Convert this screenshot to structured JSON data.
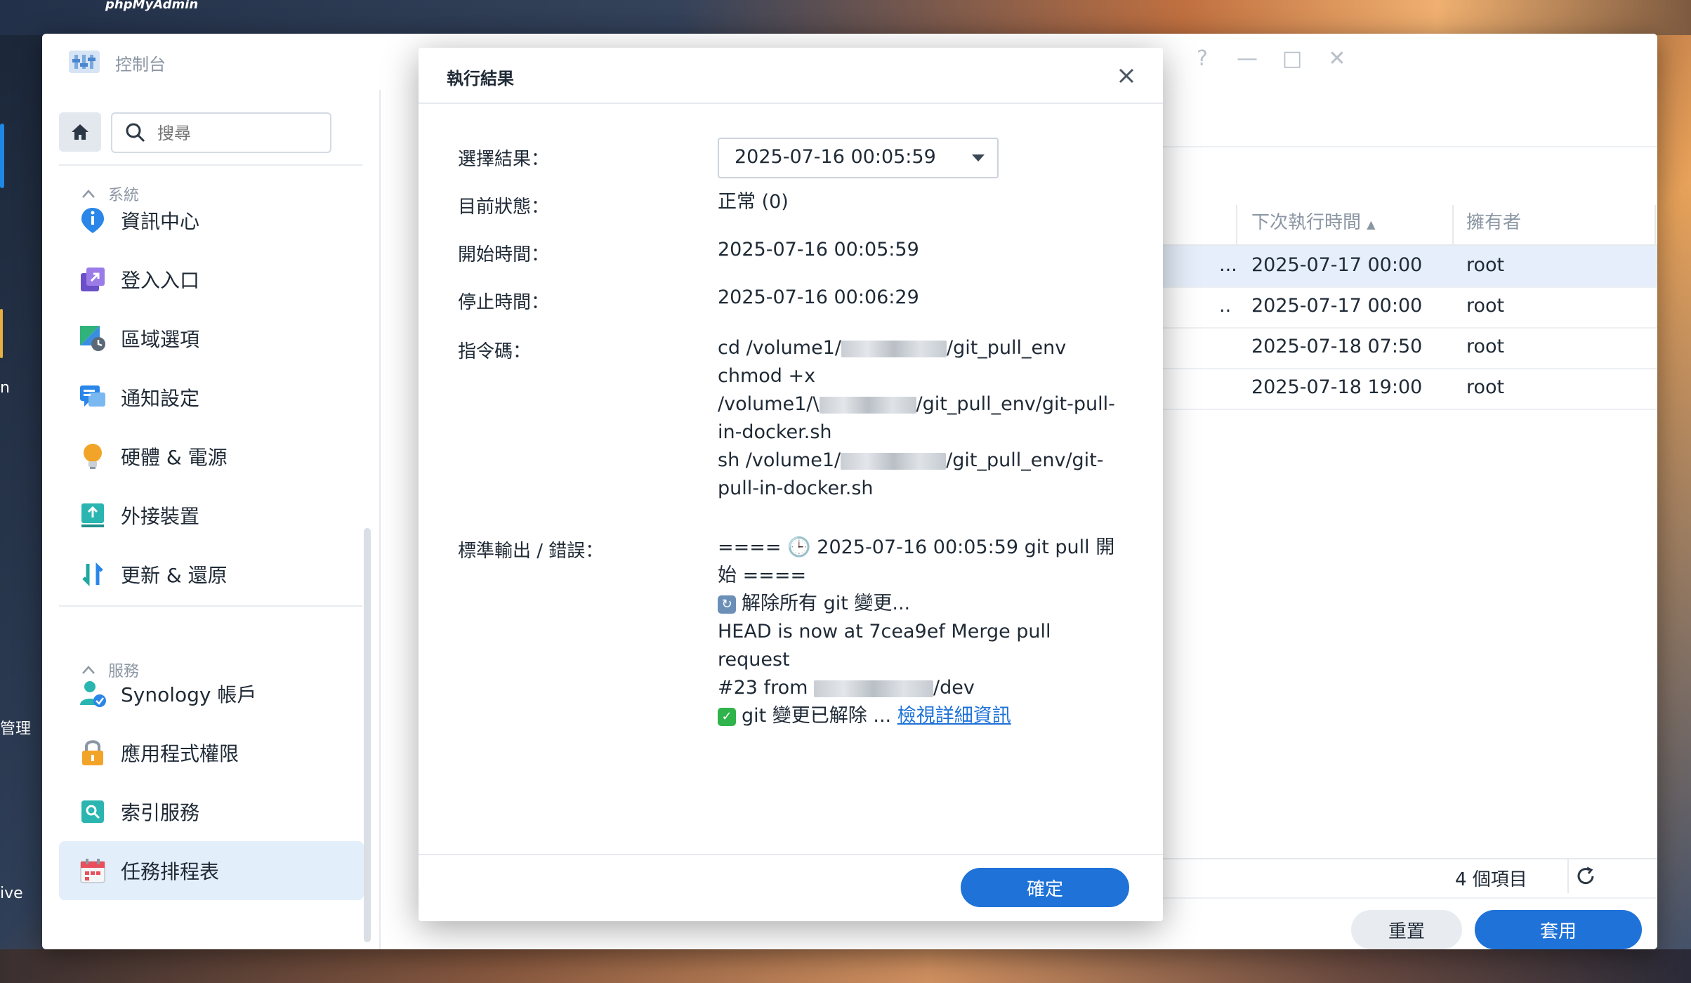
{
  "desktop": {
    "top_label": "phpMyAdmin",
    "left_label_1": "管理",
    "left_label_2": "ive",
    "left_label_3": "n"
  },
  "window": {
    "title": "控制台",
    "controls": [
      "?",
      "—",
      "□",
      "✕"
    ]
  },
  "sidebar": {
    "search_placeholder": "搜尋",
    "section_system": "系統",
    "section_services": "服務",
    "items": [
      {
        "label": "資訊中心",
        "icon": "info-icon"
      },
      {
        "label": "登入入口",
        "icon": "login-portal-icon"
      },
      {
        "label": "區域選項",
        "icon": "regional-options-icon"
      },
      {
        "label": "通知設定",
        "icon": "notification-icon"
      },
      {
        "label": "硬體 & 電源",
        "icon": "hardware-power-icon"
      },
      {
        "label": "外接裝置",
        "icon": "external-devices-icon"
      },
      {
        "label": "更新 & 還原",
        "icon": "update-restore-icon"
      },
      {
        "label": "Synology 帳戶",
        "icon": "synology-account-icon"
      },
      {
        "label": "應用程式權限",
        "icon": "app-privileges-icon"
      },
      {
        "label": "索引服務",
        "icon": "indexing-service-icon"
      },
      {
        "label": "任務排程表",
        "icon": "task-scheduler-icon"
      }
    ]
  },
  "table": {
    "headers": [
      "下次執行時間",
      "擁有者"
    ],
    "rows": [
      {
        "prefix": "...",
        "next_run": "2025-07-17 00:00",
        "owner": "root"
      },
      {
        "prefix": "..",
        "next_run": "2025-07-17 00:00",
        "owner": "root"
      },
      {
        "prefix": "",
        "next_run": "2025-07-18 07:50",
        "owner": "root"
      },
      {
        "prefix": "",
        "next_run": "2025-07-18 19:00",
        "owner": "root"
      }
    ],
    "item_count": "4 個項目",
    "reset_label": "重置",
    "apply_label": "套用"
  },
  "dialog": {
    "title": "執行結果",
    "labels": {
      "select_result": "選擇結果：",
      "current_status": "目前狀態：",
      "start_time": "開始時間：",
      "stop_time": "停止時間：",
      "command": "指令碼：",
      "output": "標準輸出 / 錯誤："
    },
    "selected_result": "2025-07-16 00:05:59",
    "status": "正常 (0)",
    "start": "2025-07-16 00:05:59",
    "stop": "2025-07-16 00:06:29",
    "command_lines": {
      "l1a": "cd /volume1/",
      "l1b": "/git_pull_env",
      "l2": "chmod +x",
      "l3a": "/volume1/\\",
      "l3b": "/git_pull_env/git-pull-",
      "l4": "in-docker.sh",
      "l5a": "sh /volume1/",
      "l5b": "/git_pull_env/git-",
      "l6": "pull-in-docker.sh"
    },
    "output_lines": {
      "o1": "==== 🕒 2025-07-16 00:05:59 git pull 開",
      "o2": "始 ====",
      "o3": "解除所有 git 變更...",
      "o4": "HEAD is now at 7cea9ef Merge pull request",
      "o5a": "#23 from",
      "o5b": "/dev",
      "o6": "git 變更已解除 ...",
      "link": "檢視詳細資訊"
    },
    "ok_label": "確定"
  },
  "colors": {
    "accent": "#1e72d8",
    "selected_row": "#e5eefa"
  }
}
